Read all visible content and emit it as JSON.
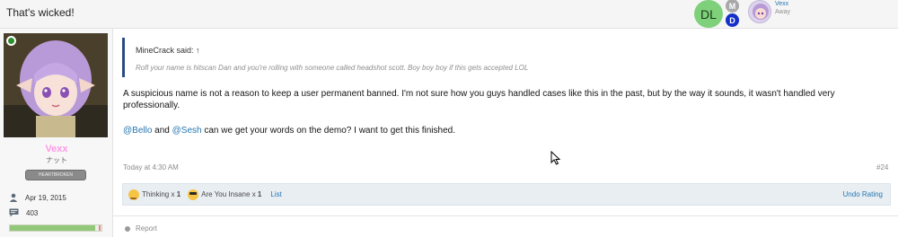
{
  "topbar": {
    "previous_post_text": "That's wicked!",
    "avatars": [
      {
        "initials": "DL",
        "color": "#7fd07a"
      },
      {
        "initials": "M",
        "color": "#a8a8a8"
      },
      {
        "initials": "D",
        "color": "#1530c9"
      }
    ],
    "user": {
      "name": "Vexx",
      "status": "Away"
    }
  },
  "sidebar": {
    "username": "Vexx",
    "subtitle": "ナット",
    "banner": "HEARTBROKEN",
    "online": true,
    "joined": "Apr 19, 2015",
    "messages": "403",
    "reputation_fill": 0.93
  },
  "quote": {
    "header": "MineCrack said: ↑",
    "body": "Rofl your name is hitscan Dan and you're rolling with someone called headshot scott. Boy boy boy if this gets accepted LOL"
  },
  "post": {
    "paragraph": "A suspicious name is not a reason to keep a user permanent banned. I'm not sure how you guys handled cases like this in the past, but by the way it sounds, it wasn't handled very professionally.",
    "mention1": "@Bello",
    "and_text": "and",
    "mention2": "@Sesh",
    "line2_rest": "can we get your words on the demo? I want to get this finished.",
    "date": "Today at 4:30 AM",
    "number": "#24"
  },
  "reactions": {
    "items": [
      {
        "label": "Thinking",
        "count_prefix": "x",
        "count": "1",
        "icon": "thinking-emoji"
      },
      {
        "label": "Are You Insane",
        "count_prefix": "x",
        "count": "1",
        "icon": "insane-emoji"
      }
    ],
    "list_label": "List",
    "undo_label": "Undo Rating"
  },
  "footer": {
    "report_label": "Report"
  },
  "colors": {
    "link": "#2577b1",
    "quote_border": "#2b4a82",
    "username": "#ff97e6"
  }
}
